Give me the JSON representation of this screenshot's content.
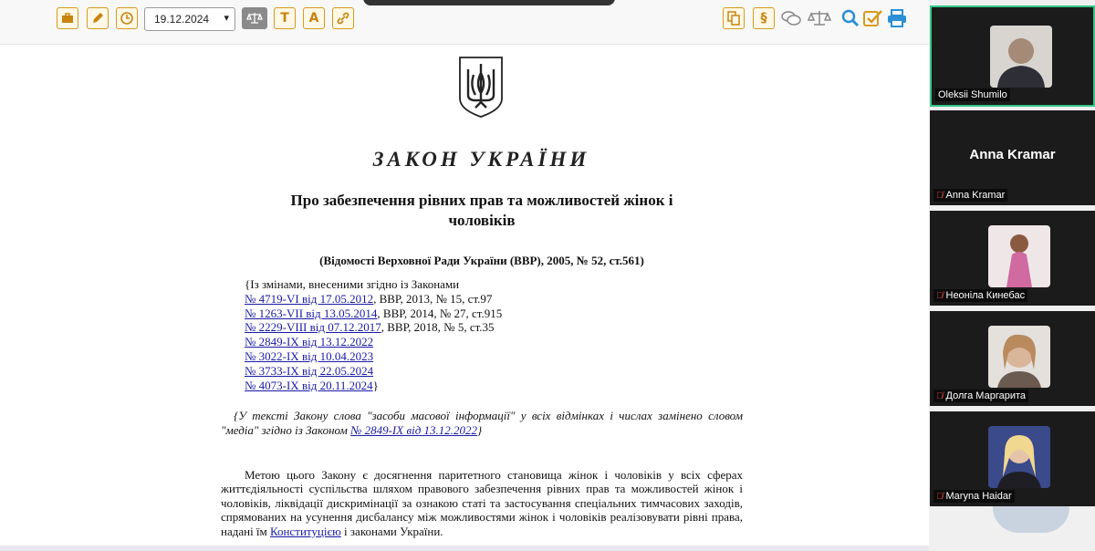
{
  "toolbar": {
    "date_value": "19.12.2024",
    "left_icons": [
      "briefcase-icon",
      "edit-icon",
      "history-icon",
      "scales-icon",
      "text-t-icon",
      "text-a-icon",
      "link-icon"
    ],
    "right_icons": [
      "copy-icon",
      "paragraph-icon",
      "comments-icon",
      "compare-scales-icon",
      "search-icon",
      "check-icon",
      "print-icon"
    ],
    "text_t": "T",
    "text_a": "A",
    "section": "§"
  },
  "document": {
    "title": "ЗАКОН УКРАЇНИ",
    "name": "Про забезпечення рівних прав та можливостей жінок і чоловіків",
    "source": "(Відомості Верховної Ради України (ВВР), 2005, № 52, ст.561)",
    "amend_intro": "{Із змінами, внесеними згідно із Законами",
    "amendments": [
      {
        "link": "№ 4719-VI від 17.05.2012",
        "rest": ", ВВР, 2013, № 15, ст.97"
      },
      {
        "link": "№ 1263-VII від 13.05.2014",
        "rest": ", ВВР, 2014, № 27, ст.915"
      },
      {
        "link": "№ 2229-VIII від 07.12.2017",
        "rest": ", ВВР, 2018, № 5, ст.35"
      },
      {
        "link": "№ 2849-IX від 13.12.2022",
        "rest": ""
      },
      {
        "link": "№ 3022-IX від 10.04.2023",
        "rest": ""
      },
      {
        "link": "№ 3733-IX від 22.05.2024",
        "rest": ""
      },
      {
        "link": "№ 4073-IX від 20.11.2024",
        "rest": "}"
      }
    ],
    "note_text": "{У тексті Закону слова \"засоби масової інформації\" у всіх відмінках і числах замінено словом \"медіа\" згідно із Законом ",
    "note_link": "№ 2849-IX від 13.12.2022",
    "note_end": "}",
    "body_text": "Метою цього Закону є досягнення паритетного становища жінок і чоловіків у всіх сферах життєдіяльності суспільства шляхом правового забезпечення рівних прав та можливостей жінок і чоловіків, ліквідації дискримінації за ознакою статі та застосування спеціальних тимчасових заходів, спрямованих на усунення дисбалансу між можливостями жінок і чоловіків реалізовувати рівні права, надані їм ",
    "body_link": "Конституцією",
    "body_end": " і законами України."
  },
  "participants": [
    {
      "name": "Oleksii Shumilo",
      "muted": false,
      "active": true,
      "photo_color": "#7a6a5e"
    },
    {
      "name": "Anna Kramar",
      "muted": true,
      "active": false,
      "big_name": "Anna Kramar"
    },
    {
      "name": "Неоніла Кинебас",
      "muted": true,
      "active": false,
      "photo_color": "#d06aa0"
    },
    {
      "name": "Долга Маргарита",
      "muted": true,
      "active": false,
      "photo_color": "#c9a68a"
    },
    {
      "name": "Maryna Haidar",
      "muted": true,
      "active": false,
      "photo_color": "#3a4a8a"
    }
  ],
  "colors": {
    "link": "#1a1aa6",
    "toolbar_icon": "#d79a1e",
    "active_border": "#35c78a",
    "search_blue": "#2a8fd6"
  }
}
